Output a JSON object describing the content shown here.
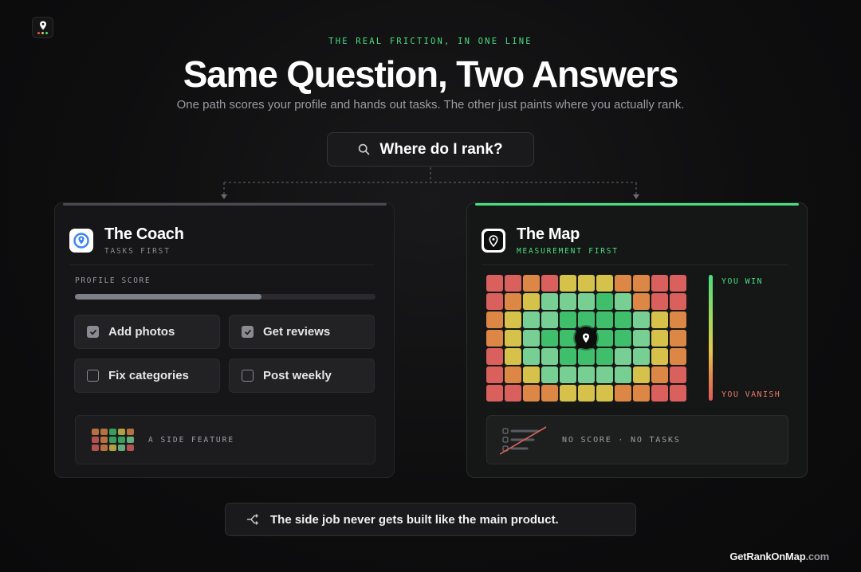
{
  "eyebrow": "THE REAL FRICTION, IN ONE LINE",
  "title": "Same Question, Two Answers",
  "subtitle": "One path scores your profile and hands out tasks. The other just paints where you actually rank.",
  "query": "Where do I rank?",
  "coach": {
    "title": "The Coach",
    "subtitle": "TASKS FIRST",
    "score_label": "PROFILE SCORE",
    "score_progress": 0.62,
    "tasks": [
      {
        "label": "Add photos",
        "checked": true
      },
      {
        "label": "Get reviews",
        "checked": true
      },
      {
        "label": "Fix categories",
        "checked": false
      },
      {
        "label": "Post weekly",
        "checked": false
      }
    ],
    "side_feature": "A SIDE FEATURE"
  },
  "map": {
    "title": "The Map",
    "subtitle": "MEASUREMENT FIRST",
    "legend_top": "YOU WIN",
    "legend_bottom": "YOU VANISH",
    "no_score": "NO SCORE · NO TASKS",
    "accent": "#4ade80"
  },
  "footer": "The side job never gets built like the main product.",
  "brand_main": "GetRankOnMap",
  "brand_tld": ".com"
}
